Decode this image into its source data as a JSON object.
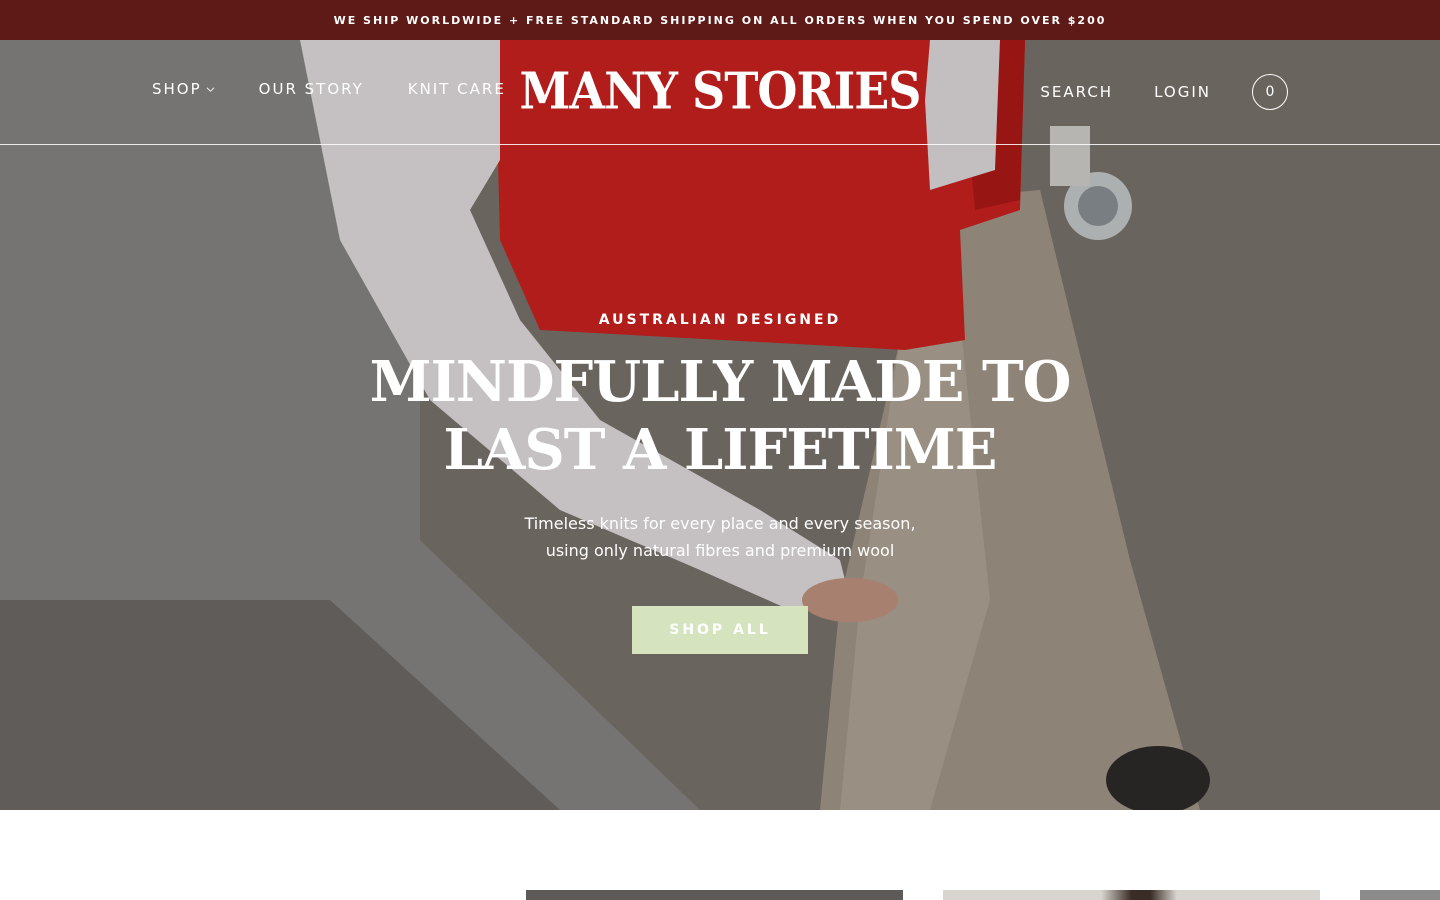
{
  "announcement": {
    "text": "WE SHIP WORLDWIDE + FREE STANDARD SHIPPING ON ALL ORDERS WHEN YOU SPEND OVER $200"
  },
  "header": {
    "logo": "MANY STORIES",
    "nav_left": [
      {
        "label": "SHOP",
        "has_dropdown": true
      },
      {
        "label": "OUR STORY"
      },
      {
        "label": "KNIT CARE"
      }
    ],
    "nav_right": [
      {
        "label": "SEARCH"
      },
      {
        "label": "LOGIN"
      }
    ],
    "cart_count": "0"
  },
  "hero": {
    "eyebrow": "AUSTRALIAN DESIGNED",
    "headline_line1": "MINDFULLY MADE TO",
    "headline_line2": "LAST A LIFETIME",
    "subline_line1": "Timeless knits for every place and every season,",
    "subline_line2": "using only natural fibres and premium wool",
    "cta_label": "SHOP ALL"
  },
  "colors": {
    "announcement_bg": "#5e1a16",
    "cta_bg": "#d5e3bf",
    "text_on_hero": "#ffffff"
  },
  "icons": {
    "dropdown": "chevron-down-icon",
    "cart": "cart-count-badge"
  }
}
